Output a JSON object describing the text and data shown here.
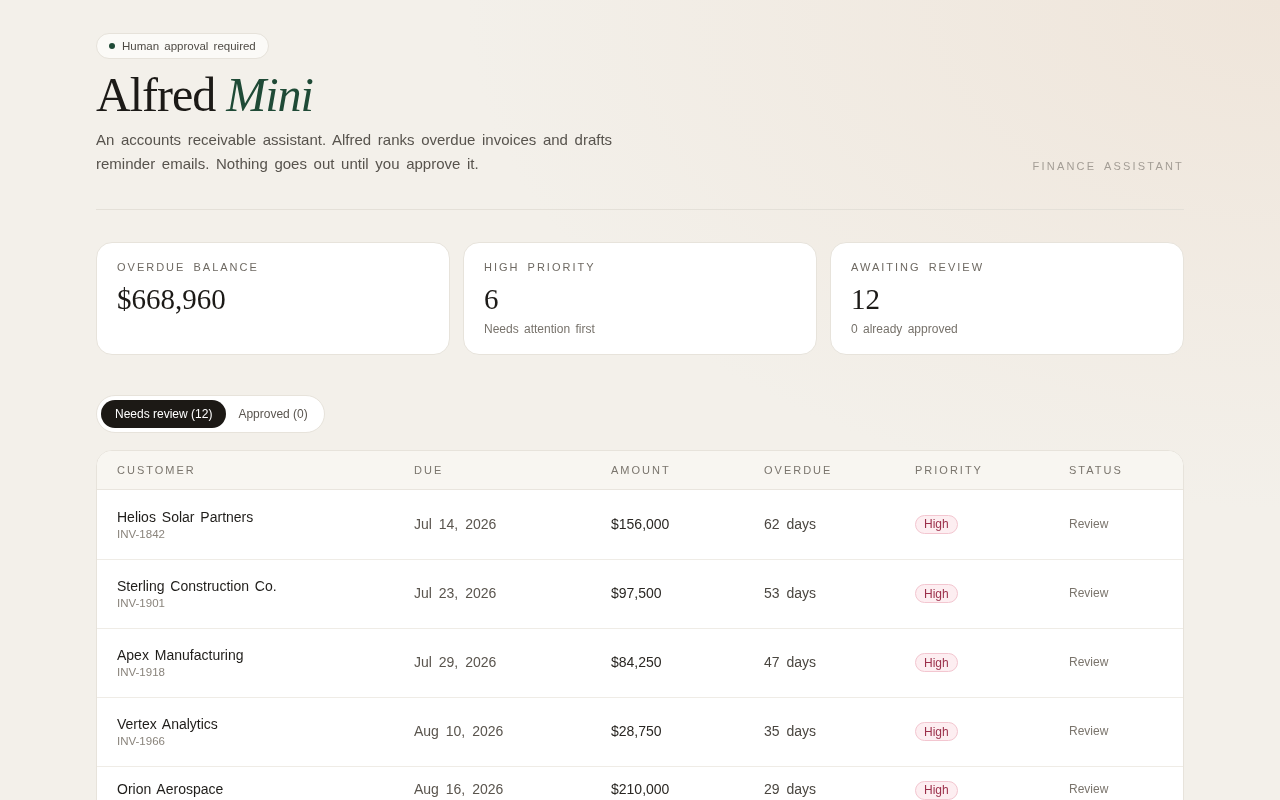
{
  "badge": {
    "label": "Human approval required"
  },
  "header": {
    "title": "Alfred *Mini*",
    "description": "An accounts receivable assistant. Alfred ranks overdue invoices and drafts reminder emails. Nothing goes out until you approve it.",
    "eyebrow": "FINANCE ASSISTANT"
  },
  "stats": [
    {
      "label": "OVERDUE BALANCE",
      "value": "$668,960"
    },
    {
      "label": "HIGH PRIORITY",
      "value": "6",
      "note": "Needs attention first"
    },
    {
      "label": "AWAITING REVIEW",
      "value": "12",
      "note": "0 already approved"
    }
  ],
  "tabs": [
    {
      "label": "Needs review (12)",
      "selected": true
    },
    {
      "label": "Approved (0)",
      "selected": false
    }
  ],
  "table": {
    "columns": [
      "CUSTOMER",
      "DUE",
      "AMOUNT",
      "OVERDUE",
      "PRIORITY",
      "STATUS"
    ],
    "rows": [
      {
        "customer": "Helios Solar Partners",
        "invoice": "INV-1842",
        "due": "Jul 14, 2026",
        "amount": "$156,000",
        "overdue": "62 days",
        "priority": "High",
        "status": "Review"
      },
      {
        "customer": "Sterling Construction Co.",
        "invoice": "INV-1901",
        "due": "Jul 23, 2026",
        "amount": "$97,500",
        "overdue": "53 days",
        "priority": "High",
        "status": "Review"
      },
      {
        "customer": "Apex Manufacturing",
        "invoice": "INV-1918",
        "due": "Jul 29, 2026",
        "amount": "$84,250",
        "overdue": "47 days",
        "priority": "High",
        "status": "Review"
      },
      {
        "customer": "Vertex Analytics",
        "invoice": "INV-1966",
        "due": "Aug 10, 2026",
        "amount": "$28,750",
        "overdue": "35 days",
        "priority": "High",
        "status": "Review"
      },
      {
        "customer": "Orion Aerospace",
        "due": "Aug 16, 2026",
        "amount": "$210,000",
        "overdue": "29 days",
        "priority": "High",
        "status": "Review"
      }
    ]
  }
}
